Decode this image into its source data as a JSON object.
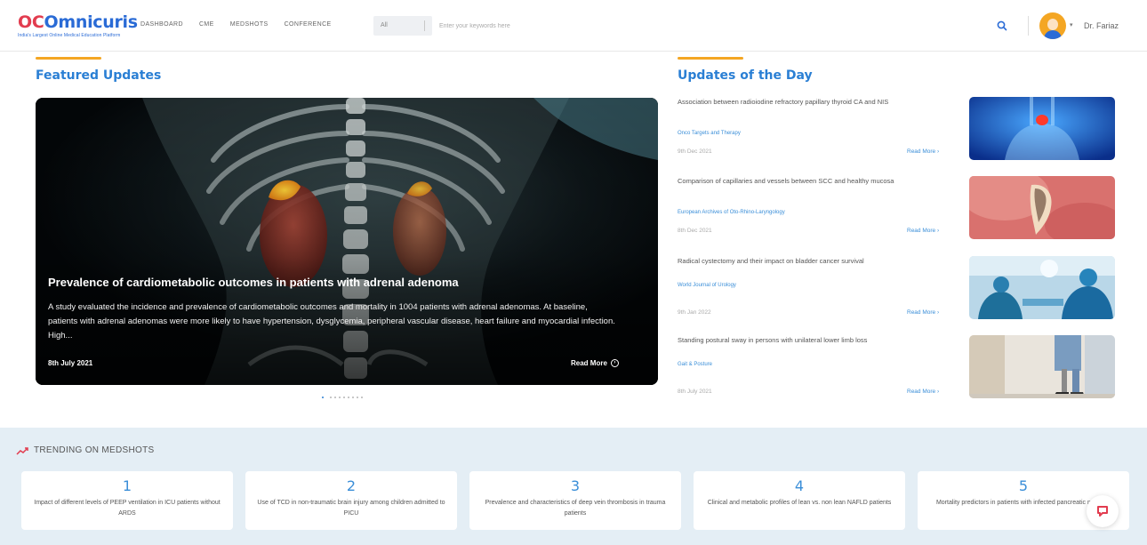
{
  "colors": {
    "brand_blue": "#2a6bd6",
    "brand_red": "#e23c4f",
    "accent_orange": "#f4a623",
    "link_blue": "#3a8ed8",
    "trending_bg": "#e4eef5"
  },
  "header": {
    "logo": {
      "prefix": "OC",
      "name": "Omnicuris",
      "tagline": "India's Largest Online Medical Education Platform"
    },
    "nav": [
      "DASHBOARD",
      "CME",
      "MEDSHOTS",
      "CONFERENCE"
    ],
    "search": {
      "filter": "All",
      "placeholder": "Enter your keywords here"
    },
    "icons": {
      "search": "search-icon",
      "user": "avatar",
      "menu": "chevron-down-icon"
    },
    "user_name": "Dr. Fariaz"
  },
  "featured": {
    "heading": "Featured Updates",
    "hero": {
      "title": "Prevalence of cardiometabolic outcomes in patients with adrenal adenoma",
      "description": "A study evaluated the incidence and prevalence of cardiometabolic outcomes and mortality in 1004 patients with adrenal adenomas. At baseline, patients with adrenal adenomas were more likely to have hypertension, dysglycemia, peripheral vascular disease, heart failure and myocardial infection. High...",
      "date": "8th July 2021",
      "read_more": "Read More"
    },
    "carousel": {
      "total": 9,
      "active": 1
    }
  },
  "updates_of_day": {
    "heading": "Updates of the Day",
    "items": [
      {
        "title": "Association between radioiodine refractory papillary thyroid CA and NIS",
        "source": "Onco Targets and Therapy",
        "date": "9th Dec 2021",
        "read_more": "Read More"
      },
      {
        "title": "Comparison of capillaries and vessels between SCC and healthy mucosa",
        "source": "European Archives of Oto-Rhino-Laryngology",
        "date": "8th Dec 2021",
        "read_more": "Read More"
      },
      {
        "title": "Radical cystectomy and their impact on bladder cancer survival",
        "source": "World Journal of Urology",
        "date": "9th Jan 2022",
        "read_more": "Read More"
      },
      {
        "title": "Standing postural sway in persons with unilateral lower limb loss",
        "source": "Gait & Posture",
        "date": "8th July 2021",
        "read_more": "Read More"
      }
    ]
  },
  "trending": {
    "heading": "TRENDING ON MEDSHOTS",
    "items": [
      {
        "rank": "1",
        "text": "Impact of different levels of PEEP ventilation in ICU patients without ARDS"
      },
      {
        "rank": "2",
        "text": "Use of TCD in non-traumatic brain injury among children admitted to PICU"
      },
      {
        "rank": "3",
        "text": "Prevalence and characteristics of deep vein thrombosis in trauma patients"
      },
      {
        "rank": "4",
        "text": "Clinical and metabolic profiles of lean vs. non lean NAFLD patients"
      },
      {
        "rank": "5",
        "text": "Mortality predictors in patients with infected pancreatic necrosis"
      }
    ]
  }
}
